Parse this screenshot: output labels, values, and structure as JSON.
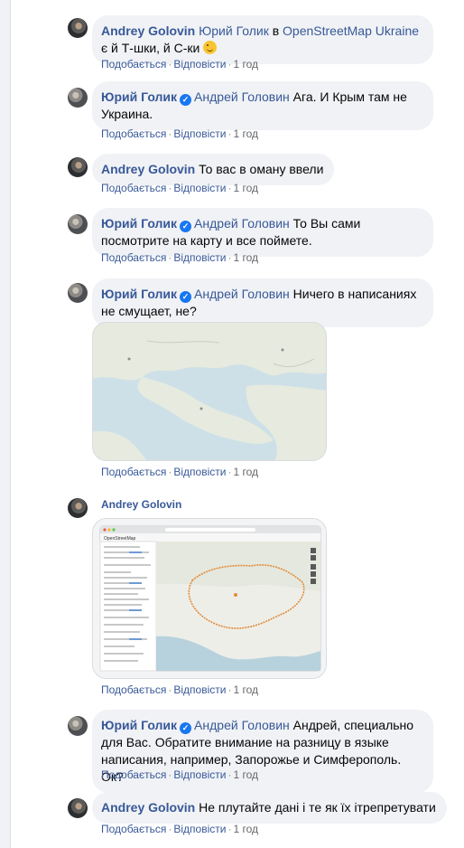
{
  "comments": [
    {
      "author": "Andrey Golovin",
      "mention": "Юрий Голик",
      "mid_text": " в ",
      "mention2": "OpenStreetMap Ukraine",
      "text": " є й Т-шки, й С-ки ",
      "emoji_icon": "smile-emoji",
      "verified": false,
      "like_label": "Подобається",
      "reply_label": "Відповісти",
      "time": "1 год"
    },
    {
      "author": "Юрий Голик",
      "mention": "Андрей Головин",
      "text": " Ага. И Крым там не Украина.",
      "verified": true,
      "like_label": "Подобається",
      "reply_label": "Відповісти",
      "time": "1 год"
    },
    {
      "author": "Andrey Golovin",
      "text": " То вас в оману ввели",
      "verified": false,
      "like_label": "Подобається",
      "reply_label": "Відповісти",
      "time": "1 год"
    },
    {
      "author": "Юрий Голик",
      "mention": "Андрей Головин",
      "text": " То Вы сами посмотрите на карту и все поймете.",
      "verified": true,
      "like_label": "Подобається",
      "reply_label": "Відповісти",
      "time": "1 год"
    },
    {
      "author": "Юрий Голик",
      "mention": "Андрей Головин",
      "text": " Ничего в написаниях не смущает, не?",
      "verified": true,
      "image": "crimsea-map-image",
      "like_label": "Подобається",
      "reply_label": "Відповісти",
      "time": "1 год"
    },
    {
      "author": "Andrey Golovin",
      "image": "osm-screenshot-image",
      "osm_title": "OpenStreetMap",
      "verified": false,
      "like_label": "Подобається",
      "reply_label": "Відповісти",
      "time": "1 год"
    },
    {
      "author": "Юрий Голик",
      "mention": "Андрей Головин",
      "text": " Андрей, специально для Вас. Обратите внимание на разницу в языке написания, например, Запорожье и Симферополь. Ок?",
      "verified": true,
      "like_label": "Подобається",
      "reply_label": "Відповісти",
      "time": "1 год"
    },
    {
      "author": "Andrey Golovin",
      "text": " Не плутайте дані і те як їх ітрепретувати",
      "verified": false,
      "like_label": "Подобається",
      "reply_label": "Відповісти",
      "time": "1 год"
    }
  ],
  "separator": "·",
  "colors": {
    "link": "#385898",
    "bubble": "#f0f2f5",
    "verified": "#1877f2",
    "meta": "#65676b"
  }
}
